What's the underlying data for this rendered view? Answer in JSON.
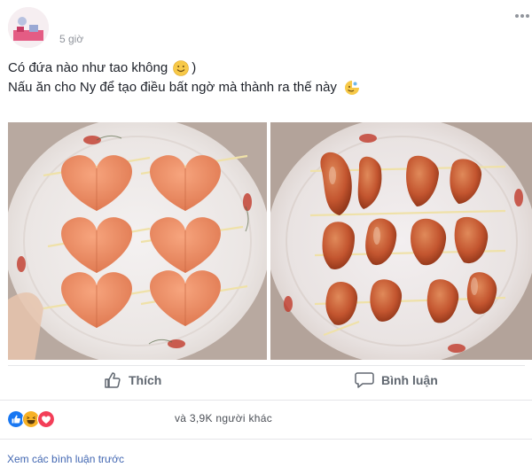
{
  "post": {
    "time": "5 giờ",
    "line1": "Có đứa nào như tao không",
    "line1_suffix": ")",
    "line2": "Nấu ăn cho Ny để tạo điều bất ngờ mà thành ra thế này",
    "photos": [
      {
        "icon": "heart-sausage-photo"
      },
      {
        "icon": "burnt-sausage-photo"
      }
    ]
  },
  "actions": {
    "like_label": "Thích",
    "comment_label": "Bình luận"
  },
  "reactions": {
    "types": [
      "like-icon",
      "haha-icon",
      "love-icon"
    ],
    "others_text": "và 3,9K người khác"
  },
  "comments": {
    "view_previous": "Xem các bình luận trước"
  },
  "colors": {
    "link": "#4267b2",
    "muted": "#90949c",
    "like_blue": "#1877f2",
    "love_red": "#f33e58",
    "haha_yellow": "#f7b125"
  }
}
